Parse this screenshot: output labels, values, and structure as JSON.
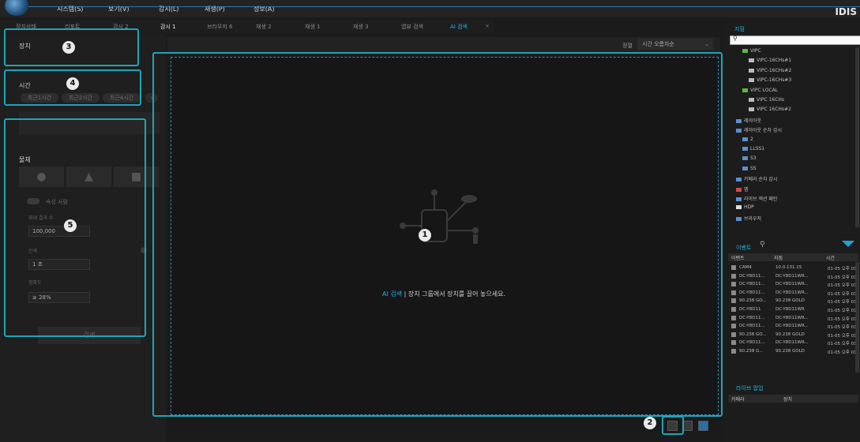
{
  "menu": [
    "시스템(S)",
    "보기(V)",
    "감시(L)",
    "재생(P)",
    "정보(A)"
  ],
  "brand": "IDIS",
  "tabs": [
    {
      "label": "장치상태",
      "state": "dim"
    },
    {
      "label": "리포트",
      "state": "dim"
    },
    {
      "label": "감시 2",
      "state": "dim"
    },
    {
      "label": "감시 1",
      "state": "on"
    },
    {
      "label": "브라우저 6",
      "state": "dim"
    },
    {
      "label": "재생 2",
      "state": "dim"
    },
    {
      "label": "재생 1",
      "state": "dim"
    },
    {
      "label": "재생 3",
      "state": "dim"
    },
    {
      "label": "앱뷰 검색",
      "state": "dim"
    },
    {
      "label": "AI 검색",
      "state": "ai"
    }
  ],
  "left": {
    "device_title": "장치",
    "time_title": "시간",
    "time_chips": [
      "최근1시간",
      "최근2시간",
      "최근4시간"
    ],
    "object_title": "물체",
    "attribute_label": "속성 사람",
    "max_results_label": "최대 결과 수",
    "max_results_value": "100,000",
    "interval_label": "간격",
    "interval_value": "1 초",
    "accuracy_label": "정확도",
    "accuracy_value": "≥ 28%",
    "search_button": "검색"
  },
  "main": {
    "sort_label": "정렬",
    "sort_value": "시간 오름차순",
    "drop_highlight": "AI 검색",
    "drop_text": " | 장치 그룹에서 장치를 끌어 놓으세요."
  },
  "callouts": [
    "1",
    "2",
    "3",
    "4",
    "5"
  ],
  "right": {
    "sites_title": "지점",
    "tree": [
      {
        "label": "VIPC",
        "level": 1,
        "color": "#5fb547"
      },
      {
        "label": "VIPC-16CHs#1",
        "level": 2,
        "color": "#bbbbbb"
      },
      {
        "label": "VIPC-16CHs#2",
        "level": 2,
        "color": "#bbbbbb"
      },
      {
        "label": "VIPC-16CHs#3",
        "level": 2,
        "color": "#bbbbbb"
      },
      {
        "label": "VIPC LOCAL",
        "level": 1,
        "color": "#5fb547"
      },
      {
        "label": "VIPC 16CHs",
        "level": 2,
        "color": "#bbbbbb"
      },
      {
        "label": "VIPC 16CHs#2",
        "level": 2,
        "color": "#bbbbbb"
      },
      {
        "label": "레이아웃",
        "level": 0,
        "color": "#5a8fd0"
      },
      {
        "label": "레이아웃 순차 감시",
        "level": 0,
        "color": "#5a8fd0"
      },
      {
        "label": "2",
        "level": 1,
        "color": "#5a8fd0"
      },
      {
        "label": "LLSS1",
        "level": 1,
        "color": "#5a8fd0"
      },
      {
        "label": "S3",
        "level": 1,
        "color": "#5a8fd0"
      },
      {
        "label": "SS",
        "level": 1,
        "color": "#5a8fd0"
      },
      {
        "label": "카메라 순차 감시",
        "level": 0,
        "color": "#5a8fd0"
      },
      {
        "label": "맵",
        "level": 0,
        "color": "#d04a4a"
      },
      {
        "label": "라이브 액션 패인",
        "level": 0,
        "color": "#5a8fd0"
      },
      {
        "label": "HDP",
        "level": 0,
        "color": "#dddddd"
      },
      {
        "label": "브라우저",
        "level": 0,
        "color": "#5a8fd0"
      }
    ],
    "events_title": "이벤트",
    "event_columns": [
      "이벤트",
      "지점",
      "시간"
    ],
    "events": [
      [
        "CAM4",
        "10.0.131.15",
        "01-05 오후 01:"
      ],
      [
        "DC-Y8D11...",
        "DC-Y8D11WR...",
        "01-05 오후 01:..."
      ],
      [
        "DC-Y8D11...",
        "DC-Y8D11WR...",
        "01-05 오후 01:..."
      ],
      [
        "DC-Y8D11...",
        "DC-Y8D11WR...",
        "01-05 오후 01:..."
      ],
      [
        "90.238 GO...",
        "90.238 GOLD",
        "01-05 오후 01:..."
      ],
      [
        "DC-Y8D11",
        "DC-Y8D11WR",
        "01-05 오후 01:"
      ],
      [
        "DC-Y8D11...",
        "DC-Y8D11WR...",
        "01-05 오후 01:..."
      ],
      [
        "DC-Y8D11...",
        "DC-Y8D11WR...",
        "01-05 오후 01:..."
      ],
      [
        "90.238 GO...",
        "90.238 GOLD",
        "01-05 오후 01:..."
      ],
      [
        "DC-Y8D11...",
        "DC-Y8D11WR...",
        "01-05 오후 01:..."
      ],
      [
        "90.238 G...",
        "90.238 GOLD",
        "01-05 오후 01..."
      ]
    ],
    "live_popup_title": "라이브 팝업",
    "popup_columns": [
      "카메라",
      "장치"
    ]
  }
}
